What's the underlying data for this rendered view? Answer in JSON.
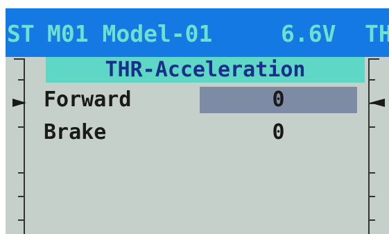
{
  "header": {
    "left_label": "ST",
    "model_name": "M01 Model-01",
    "voltage": "6.6V",
    "right_label": "TH"
  },
  "menu": {
    "title": "THR-Acceleration",
    "rows": [
      {
        "label": "Forward",
        "value": "0"
      },
      {
        "label": "Brake",
        "value": "0"
      }
    ]
  },
  "colors": {
    "header_bg": "#1479e3",
    "header_text": "#6ee0d0",
    "title_bg": "#5fd7c7",
    "title_text": "#1a2f8c",
    "screen_bg": "#c6d0cb",
    "selection_bg": "#7d8ba5"
  }
}
